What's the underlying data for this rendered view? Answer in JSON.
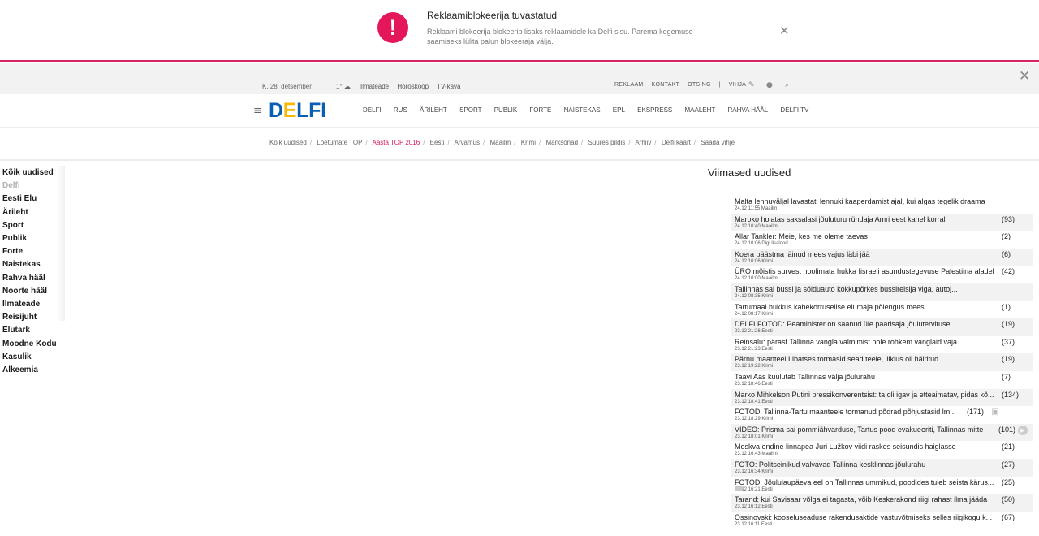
{
  "adblock": {
    "alert_icon": "!",
    "title": "Reklaamiblokeerija tuvastatud",
    "text": "Reklaami blokeerija blokeerib lisaks reklaamidele ka Delfi sisu. Parema kogemuse saamiseks lülita palun blokeeraja välja.",
    "close_icon": "✕"
  },
  "topbar": {
    "date": "K, 28. detsember",
    "weather": "1° ☁",
    "links_left": [
      "Ilmateade",
      "Horoskoop",
      "TV-kava"
    ],
    "links_right": [
      "REKLAAM",
      "KONTAKT",
      "OTSING",
      "|",
      "VIHJA"
    ],
    "close_icon": "✕"
  },
  "mainnav": {
    "burger_icon": "≡",
    "logo": {
      "d": "D",
      "e": "E",
      "rest": "LFI"
    },
    "items": [
      "DELFI",
      "RUS",
      "ÄRILEHT",
      "SPORT",
      "PUBLIK",
      "FORTE",
      "NAISTEKAS",
      "EPL",
      "EKSPRESS",
      "MAALEHT",
      "RAHVA HÄÄL",
      "DELFI TV"
    ]
  },
  "subnav": {
    "items": [
      "Kõik uudised",
      "Loetumate TOP",
      "Aasta TOP 2016",
      "Eesti",
      "Arvamus",
      "Maailm",
      "Krimi",
      "Märksõnad",
      "Suures pildis",
      "Arhiiv",
      "Delfi kaart",
      "Saada vihje"
    ],
    "highlight_color": "#d8175c"
  },
  "sidebar": {
    "items": [
      "Kõik uudised",
      "Delfi",
      "Eesti Elu",
      "Ärileht",
      "Sport",
      "Publik",
      "Forte",
      "Naistekas",
      "Rahva hääl",
      "Noorte hääl",
      "Ilmateade",
      "Reisijuht",
      "Elutark",
      "Moodne Kodu",
      "Kasulik",
      "Alkeemia"
    ]
  },
  "latest": {
    "heading": "Viimased uudised",
    "rows": [
      {
        "title": "Malta lennuväljal lavastati lennuki kaaperdamist ajal, kui algas tegelik draama",
        "count": "",
        "meta": "24.12 11:55 Maailm",
        "icon": ""
      },
      {
        "title": "Maroko hoiatas saksalasi jõuluturu ründaja Amri eest kahel korral",
        "count": "(93)",
        "meta": "24.12 10:40 Maailm",
        "icon": ""
      },
      {
        "title": "Allar Tankler: Meie, kes me oleme taevas",
        "count": "(2)",
        "meta": "24.12 10:06 Digi lisalood",
        "icon": ""
      },
      {
        "title": "Koera päästma läinud mees vajus läbi jää",
        "count": "(6)",
        "meta": "24.12 10:06 Krimi",
        "icon": ""
      },
      {
        "title": "ÜRO mõistis survest hoolimata hukka Iisraeli asundustegevuse Palestiina aladel",
        "count": "(42)",
        "meta": "24.12 10:00 Maailm",
        "icon": ""
      },
      {
        "title": "Tallinnas sai bussi ja sõiduauto kokkupõrkes bussireisija viga, autoj...",
        "count": "",
        "meta": "24.12 08:35 Krimi",
        "icon": ""
      },
      {
        "title": "Tartumaal hukkus kahekorruselise elumaja põlengus mees",
        "count": "(1)",
        "meta": "24.12 08:17 Krimi",
        "icon": ""
      },
      {
        "title": "DELFI FOTOD: Peaminister on saanud üle paarisaja jõulutervituse",
        "count": "(19)",
        "meta": "23.12 21:26 Eesti",
        "icon": ""
      },
      {
        "title": "Reinsalu: pärast Tallinna vangla valmimist pole rohkem vanglaid vaja",
        "count": "(37)",
        "meta": "23.12 21:23 Eesti",
        "icon": ""
      },
      {
        "title": "Pärnu maanteel Libatses tormasid sead teele, liiklus oli häiritud",
        "count": "(19)",
        "meta": "23.12 19:22 Krimi",
        "icon": ""
      },
      {
        "title": "Taavi Aas kuulutab Tallinnas välja jõulurahu",
        "count": "(7)",
        "meta": "23.12 18:46 Eesti",
        "icon": ""
      },
      {
        "title": "Marko Mihkelson Putini pressikonverentsist: ta oli igav ja etteaimatav, pidas kõ...",
        "count": "(134)",
        "meta": "23.12 18:41 Eesti",
        "icon": ""
      },
      {
        "title": "FOTOD: Tallinna-Tartu maanteele tormanud põdrad põhjustasid lm...",
        "count": "(171)",
        "meta": "23.12 18:29 Krimi",
        "icon": "camera"
      },
      {
        "title": "VIDEO: Prisma sai pommiähvarduse, Tartus pood evakueeriti, Tallinnas mitte",
        "count": "(101)",
        "meta": "23.12 18:01 Krimi",
        "icon": "play"
      },
      {
        "title": "Moskva endine linnapea Juri Lužkov viidi raskes seisundis haiglasse",
        "count": "(21)",
        "meta": "23.12 16:43 Maailm",
        "icon": ""
      },
      {
        "title": "FOTO: Politseinikud valvavad Tallinna kesklinnas jõulurahu",
        "count": "(27)",
        "meta": "23.12 16:34 Krimi",
        "icon": ""
      },
      {
        "title": "FOTOD: Jõululaupäeva eel on Tallinnas ummikud, poodides tuleb seista kärus...",
        "count": "(25)",
        "meta": "23.12 16:21 Eesti",
        "icon": "tiny"
      },
      {
        "title": "Tarand: kui Savisaar võlga ei tagasta, võib Keskerakond riigi rahast ilma jääda",
        "count": "(50)",
        "meta": "23.12 16:12 Eesti",
        "icon": ""
      },
      {
        "title": "Ossinovski: kooseluseaduse rakendusaktide vastuvõtmiseks selles riigikogu k...",
        "count": "(67)",
        "meta": "23.12 16:11 Eesti",
        "icon": ""
      }
    ]
  }
}
